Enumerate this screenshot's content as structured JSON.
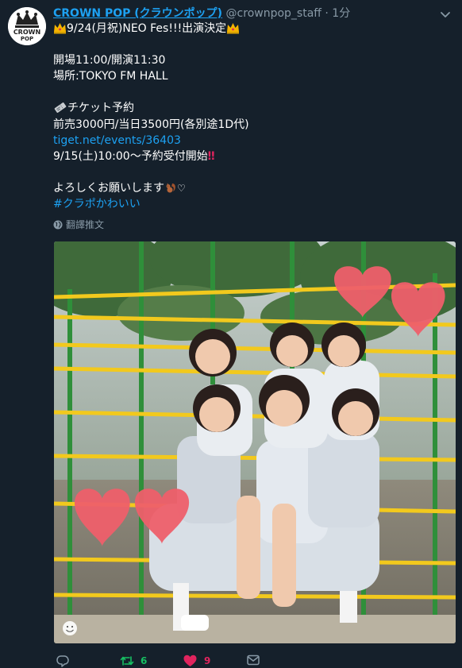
{
  "tweet": {
    "display_name": "CROWN POP (クラウンポップ)",
    "handle": "@crownpop_staff",
    "dot": "·",
    "time": "1分",
    "avatar_text": [
      "CROWN",
      "POP"
    ],
    "lines": {
      "l1": "9/24(月祝)NEO Fes!!!出演決定",
      "l2": "開場11:00/開演11:30",
      "l3": "場所:TOKYO FM HALL",
      "l4": "チケット予約",
      "l5": "前売3000円/当日3500円(各別途1D代)",
      "l6": "tiget.net/events/36403",
      "l7a": "9/15(土)10:00〜予約受付開始",
      "l7b": "‼",
      "l8a": "よろしくお願いします",
      "l8b": "♡",
      "l9": "#クラポかわいい"
    },
    "translate": "翻譯推文"
  },
  "actions": {
    "reply_count": "",
    "retweet_count": "6",
    "like_count": "9"
  },
  "colors": {
    "background": "#15202b",
    "link": "#1da1f2",
    "muted": "#8899a6",
    "retweet": "#17bf63",
    "like": "#e0245e"
  }
}
